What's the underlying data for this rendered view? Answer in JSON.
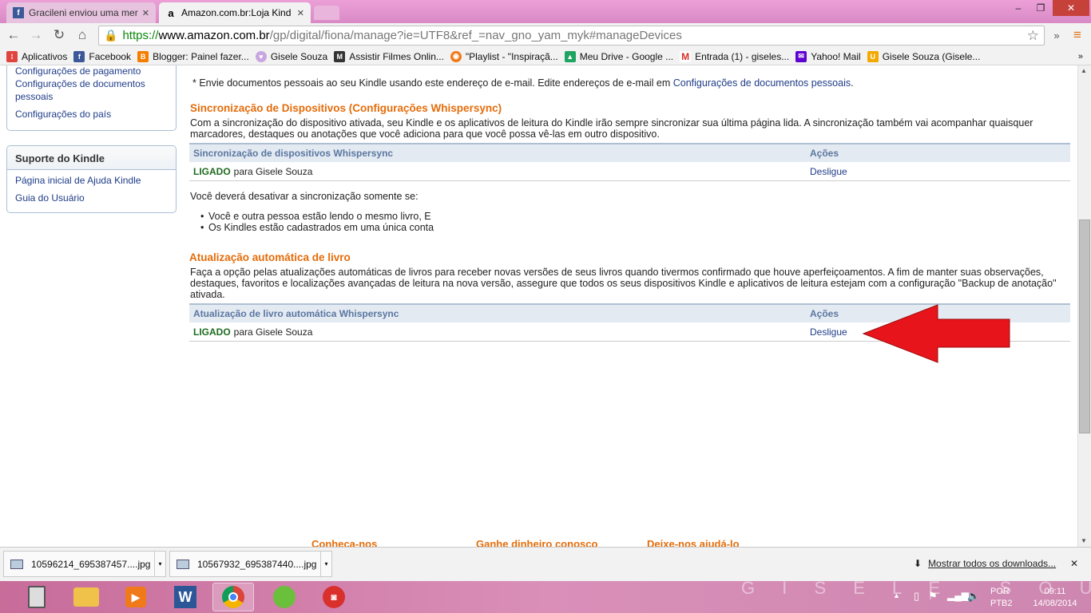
{
  "tabs": [
    {
      "title": "Gracileni enviou uma mer",
      "favicon": "facebook-icon"
    },
    {
      "title": "Amazon.com.br:Loja Kind",
      "favicon": "amazon-icon"
    }
  ],
  "window": {
    "minimize": "‒",
    "maximize": "❐",
    "close": "✕"
  },
  "address": {
    "scheme": "https://",
    "host": "www.amazon.com.br",
    "path": "/gp/digital/fiona/manage?ie=UTF8&ref_=nav_gno_yam_myk#manageDevices"
  },
  "bookmarks": [
    {
      "label": "Aplicativos",
      "icon": "apps-grid-icon",
      "color": "#e0443e"
    },
    {
      "label": "Facebook",
      "icon": "facebook-icon",
      "color": "#3b5998"
    },
    {
      "label": "Blogger: Painel fazer...",
      "icon": "blogger-icon",
      "color": "#f57d00"
    },
    {
      "label": "Gisele Souza",
      "icon": "heart-icon",
      "color": "#c9a6e0"
    },
    {
      "label": "Assistir Filmes Onlin...",
      "icon": "mf-icon",
      "color": "#333333"
    },
    {
      "label": "\"Playlist - \"Inspiraçã...",
      "icon": "playlist-icon",
      "color": "#f07a1a"
    },
    {
      "label": "Meu Drive - Google ...",
      "icon": "drive-icon",
      "color": "#1fa463"
    },
    {
      "label": "Entrada (1) - giseles...",
      "icon": "gmail-icon",
      "color": "#d93025"
    },
    {
      "label": "Yahoo! Mail",
      "icon": "yahoo-mail-icon",
      "color": "#5f01d1"
    },
    {
      "label": "Gisele Souza (Gisele...",
      "icon": "bookmark-u-icon",
      "color": "#f2a900"
    }
  ],
  "sidebar": {
    "box1_links": [
      "Configurações de pagamento",
      "Configurações de documentos pessoais",
      "Configurações do país"
    ],
    "box2_title": "Suporte do Kindle",
    "box2_links": [
      "Página inicial de Ajuda Kindle",
      "Guia do Usuário"
    ]
  },
  "main": {
    "note_prefix": "* Envie documentos pessoais ao seu Kindle usando este endereço de e-mail. Edite endereços de e-mail em ",
    "note_link": "Configurações de documentos pessoais",
    "note_suffix": ".",
    "sync": {
      "title": "Sincronização de Dispositivos (Configurações Whispersync)",
      "desc": "Com a sincronização do dispositivo ativada, seu Kindle e os aplicativos de leitura do Kindle irão sempre sincronizar sua última página lida. A sincronização também vai acompanhar quaisquer marcadores, destaques ou anotações que você adiciona para que você possa vê-las em outro dispositivo.",
      "col1": "Sincronização de dispositivos Whispersync",
      "col2": "Ações",
      "status": "LIGADO",
      "owner": "para Gisele Souza",
      "action": "Desligue",
      "only_if": "Você deverá desativar a sincronização somente se:",
      "bullets": [
        "Você e outra pessoa estão lendo o mesmo livro, E",
        "Os Kindles estão cadastrados em uma única conta"
      ]
    },
    "auto": {
      "title": "Atualização automática de livro",
      "desc": "Faça a opção pelas atualizações automáticas de livros para receber novas versões de seus livros quando tivermos confirmado que houve aperfeiçoamentos. A fim de manter suas observações, destaques, favoritos e localizações avançadas de leitura na nova versão, assegure que todos os seus dispositivos Kindle e aplicativos de leitura estejam com a configuração \"Backup de anotação\" ativada.",
      "col1": "Atualização de livro automática Whispersync",
      "col2": "Ações",
      "status": "LIGADO",
      "owner": "para Gisele Souza",
      "action": "Desligue"
    },
    "footer": [
      "Conheça-nos",
      "Ganhe dinheiro conosco",
      "Deixe-nos ajudá-lo"
    ]
  },
  "annotation_arrow_color": "#e8141c",
  "downloads": {
    "items": [
      "10596214_695387457....jpg",
      "10567932_695387440....jpg"
    ],
    "show_all": "Mostrar todos os downloads...",
    "close": "✕"
  },
  "taskbar": {
    "lang": "POR",
    "layout": "PTB2",
    "time": "09:11",
    "date": "14/08/2014",
    "watermark": "G I S E L E   S O U Z A"
  }
}
